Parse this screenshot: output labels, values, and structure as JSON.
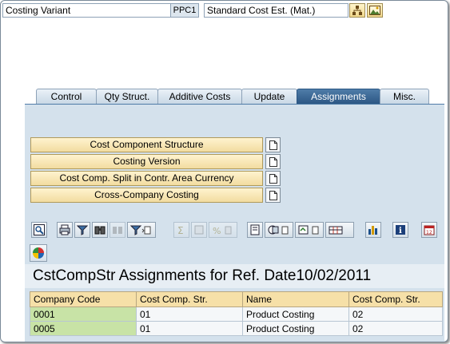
{
  "header": {
    "costing_variant_label": "Costing Variant",
    "costing_variant_code": "PPC1",
    "costing_variant_desc": "Standard Cost Est. (Mat.)"
  },
  "tabs": [
    {
      "label": "Control",
      "active": false
    },
    {
      "label": "Qty Struct.",
      "active": false
    },
    {
      "label": "Additive Costs",
      "active": false
    },
    {
      "label": "Update",
      "active": false
    },
    {
      "label": "Assignments",
      "active": true
    },
    {
      "label": "Misc.",
      "active": false
    }
  ],
  "assignment_buttons": [
    "Cost Component Structure",
    "Costing Version",
    "Cost Comp. Split in Contr. Area Currency",
    "Cross-Company Costing"
  ],
  "toolbar_icons": [
    "details-icon",
    "print-icon",
    "filter-icon",
    "find-icon",
    "find-next-icon",
    "set-filter-icon",
    "sum-icon",
    "subtotal-icon",
    "percent-icon",
    "print-preview-icon",
    "export-icon",
    "send-icon",
    "layout-icon",
    "graphic-icon",
    "info-icon",
    "calendar-icon"
  ],
  "alv": {
    "title": "CstCompStr Assignments for Ref. Date10/02/2011",
    "columns": [
      "Company Code",
      "Cost Comp. Str.",
      "Name",
      "Cost Comp. Str."
    ],
    "rows": [
      [
        "0001",
        "01",
        "Product Costing",
        "02"
      ],
      [
        "0005",
        "01",
        "Product Costing",
        "02"
      ]
    ]
  },
  "colors": {
    "active_tab": "#2c5784",
    "panel_bg": "#d4e1ec",
    "header_cell": "#f6e0a8",
    "key_cell": "#c8e3a6"
  }
}
